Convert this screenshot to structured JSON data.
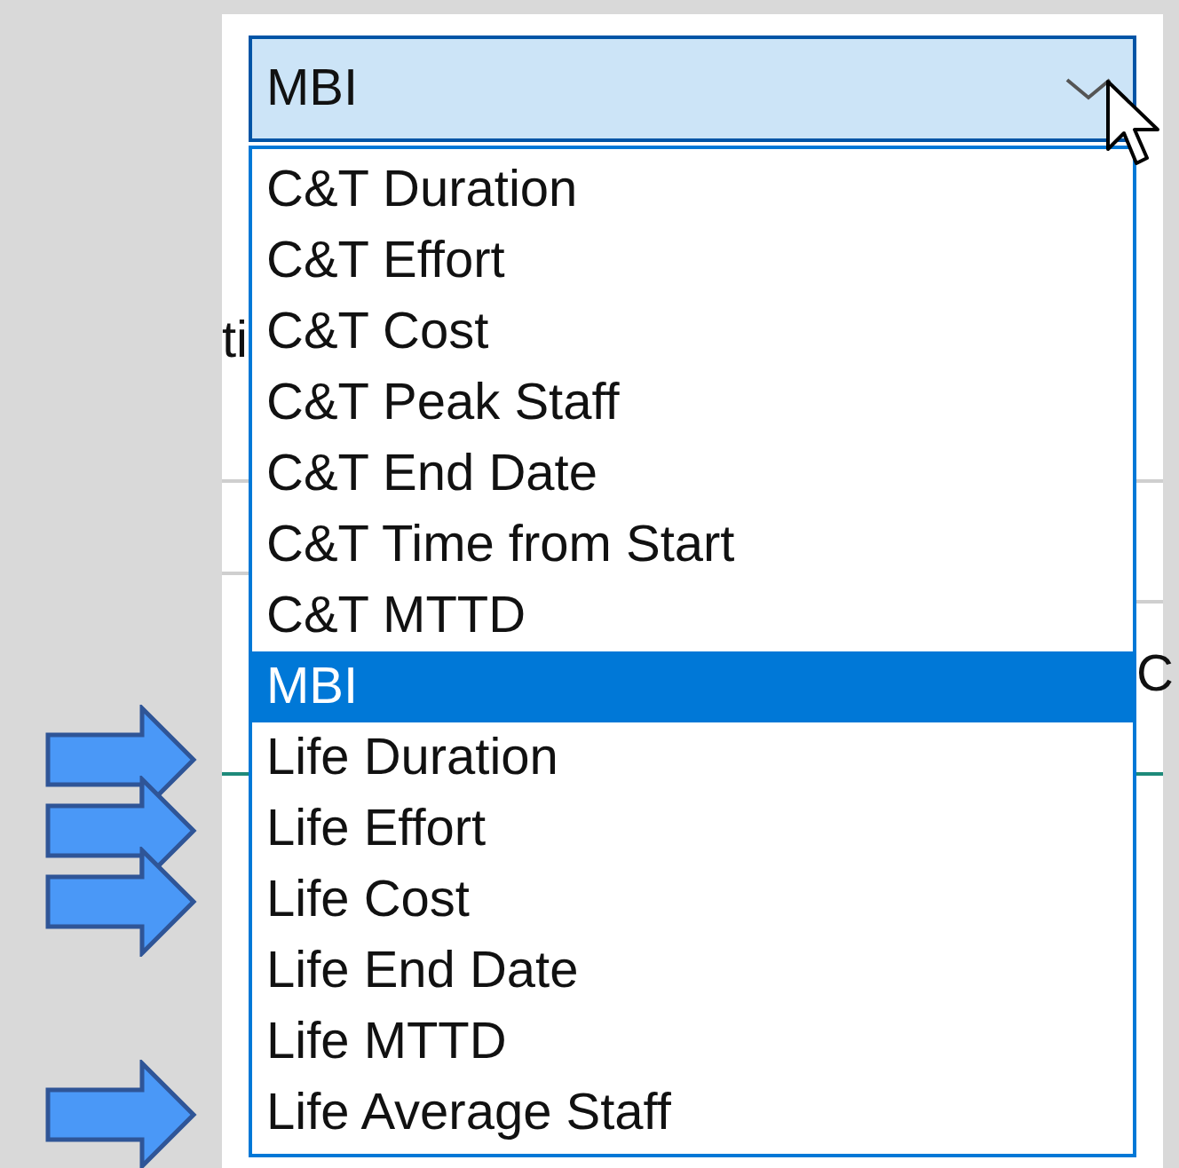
{
  "background": {
    "left_fragment": "ti",
    "right_fragment": "C"
  },
  "combobox": {
    "value": "MBI",
    "expanded": true
  },
  "options": [
    {
      "label": "C&T Duration",
      "selected": false,
      "flagged": false
    },
    {
      "label": "C&T Effort",
      "selected": false,
      "flagged": false
    },
    {
      "label": "C&T Cost",
      "selected": false,
      "flagged": false
    },
    {
      "label": "C&T Peak Staff",
      "selected": false,
      "flagged": false
    },
    {
      "label": "C&T End Date",
      "selected": false,
      "flagged": false
    },
    {
      "label": "C&T Time from Start",
      "selected": false,
      "flagged": false
    },
    {
      "label": "C&T MTTD",
      "selected": false,
      "flagged": false
    },
    {
      "label": "MBI",
      "selected": true,
      "flagged": false
    },
    {
      "label": "Life Duration",
      "selected": false,
      "flagged": true
    },
    {
      "label": "Life Effort",
      "selected": false,
      "flagged": true
    },
    {
      "label": "Life Cost",
      "selected": false,
      "flagged": true
    },
    {
      "label": "Life End Date",
      "selected": false,
      "flagged": false
    },
    {
      "label": "Life MTTD",
      "selected": false,
      "flagged": false
    },
    {
      "label": "Life Average Staff",
      "selected": false,
      "flagged": true
    }
  ]
}
